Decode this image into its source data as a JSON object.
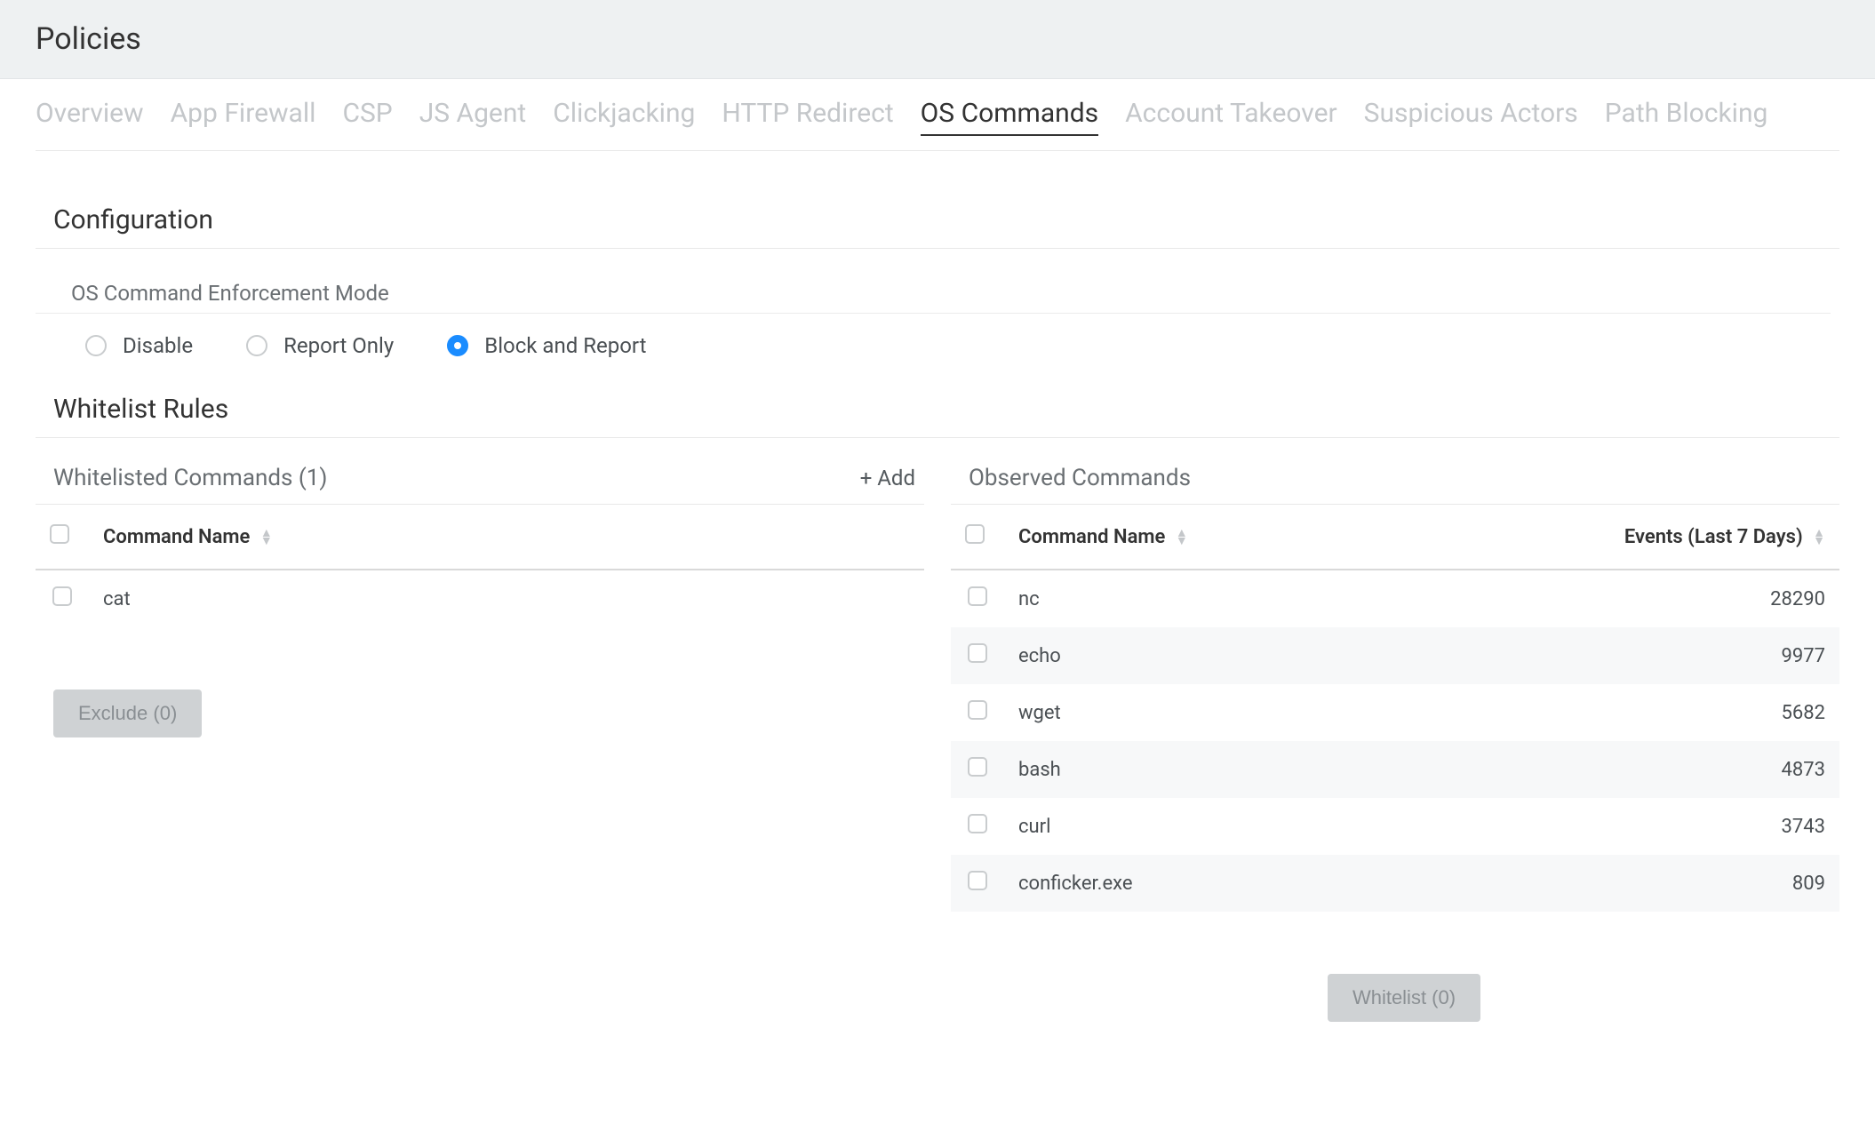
{
  "header": {
    "title": "Policies"
  },
  "tabs": [
    {
      "label": "Overview",
      "active": false
    },
    {
      "label": "App Firewall",
      "active": false
    },
    {
      "label": "CSP",
      "active": false
    },
    {
      "label": "JS Agent",
      "active": false
    },
    {
      "label": "Clickjacking",
      "active": false
    },
    {
      "label": "HTTP Redirect",
      "active": false
    },
    {
      "label": "OS Commands",
      "active": true
    },
    {
      "label": "Account Takeover",
      "active": false
    },
    {
      "label": "Suspicious Actors",
      "active": false
    },
    {
      "label": "Path Blocking",
      "active": false
    }
  ],
  "configuration": {
    "section_title": "Configuration",
    "enforcement_label": "OS Command Enforcement Mode",
    "options": [
      {
        "label": "Disable",
        "selected": false
      },
      {
        "label": "Report Only",
        "selected": false
      },
      {
        "label": "Block and Report",
        "selected": true
      }
    ]
  },
  "whitelist_rules": {
    "section_title": "Whitelist Rules",
    "whitelisted": {
      "title": "Whitelisted Commands (1)",
      "add_label": "+ Add",
      "columns": {
        "name": "Command Name"
      },
      "rows": [
        {
          "name": "cat"
        }
      ],
      "exclude_button": "Exclude (0)"
    },
    "observed": {
      "title": "Observed Commands",
      "columns": {
        "name": "Command Name",
        "events": "Events (Last 7 Days)"
      },
      "rows": [
        {
          "name": "nc",
          "events": "28290"
        },
        {
          "name": "echo",
          "events": "9977"
        },
        {
          "name": "wget",
          "events": "5682"
        },
        {
          "name": "bash",
          "events": "4873"
        },
        {
          "name": "curl",
          "events": "3743"
        },
        {
          "name": "conficker.exe",
          "events": "809"
        }
      ],
      "whitelist_button": "Whitelist (0)"
    }
  }
}
